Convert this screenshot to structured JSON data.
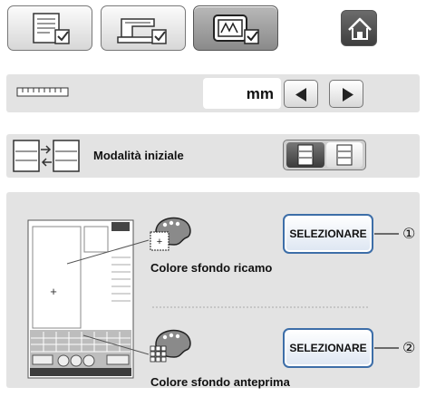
{
  "tabs": [
    {
      "icon": "settings-page-icon",
      "active": false
    },
    {
      "icon": "sewing-machine-settings-icon",
      "active": false
    },
    {
      "icon": "embroidery-settings-icon",
      "active": true
    }
  ],
  "home": {
    "icon": "home-icon"
  },
  "unit_row": {
    "icon": "ruler-icon",
    "value": "mm",
    "prev_icon": "arrow-left-icon",
    "next_icon": "arrow-right-icon"
  },
  "mode_row": {
    "icon": "mode-switch-icon",
    "label": "Modalità iniziale",
    "option_icons": [
      "embroidery-mode-icon",
      "edit-mode-icon"
    ]
  },
  "background_settings": {
    "embroidery": {
      "label": "Colore sfondo ricamo",
      "button": "SELEZIONARE",
      "callout": "①"
    },
    "preview": {
      "label": "Colore sfondo anteprima",
      "button": "SELEZIONARE",
      "callout": "②"
    }
  }
}
